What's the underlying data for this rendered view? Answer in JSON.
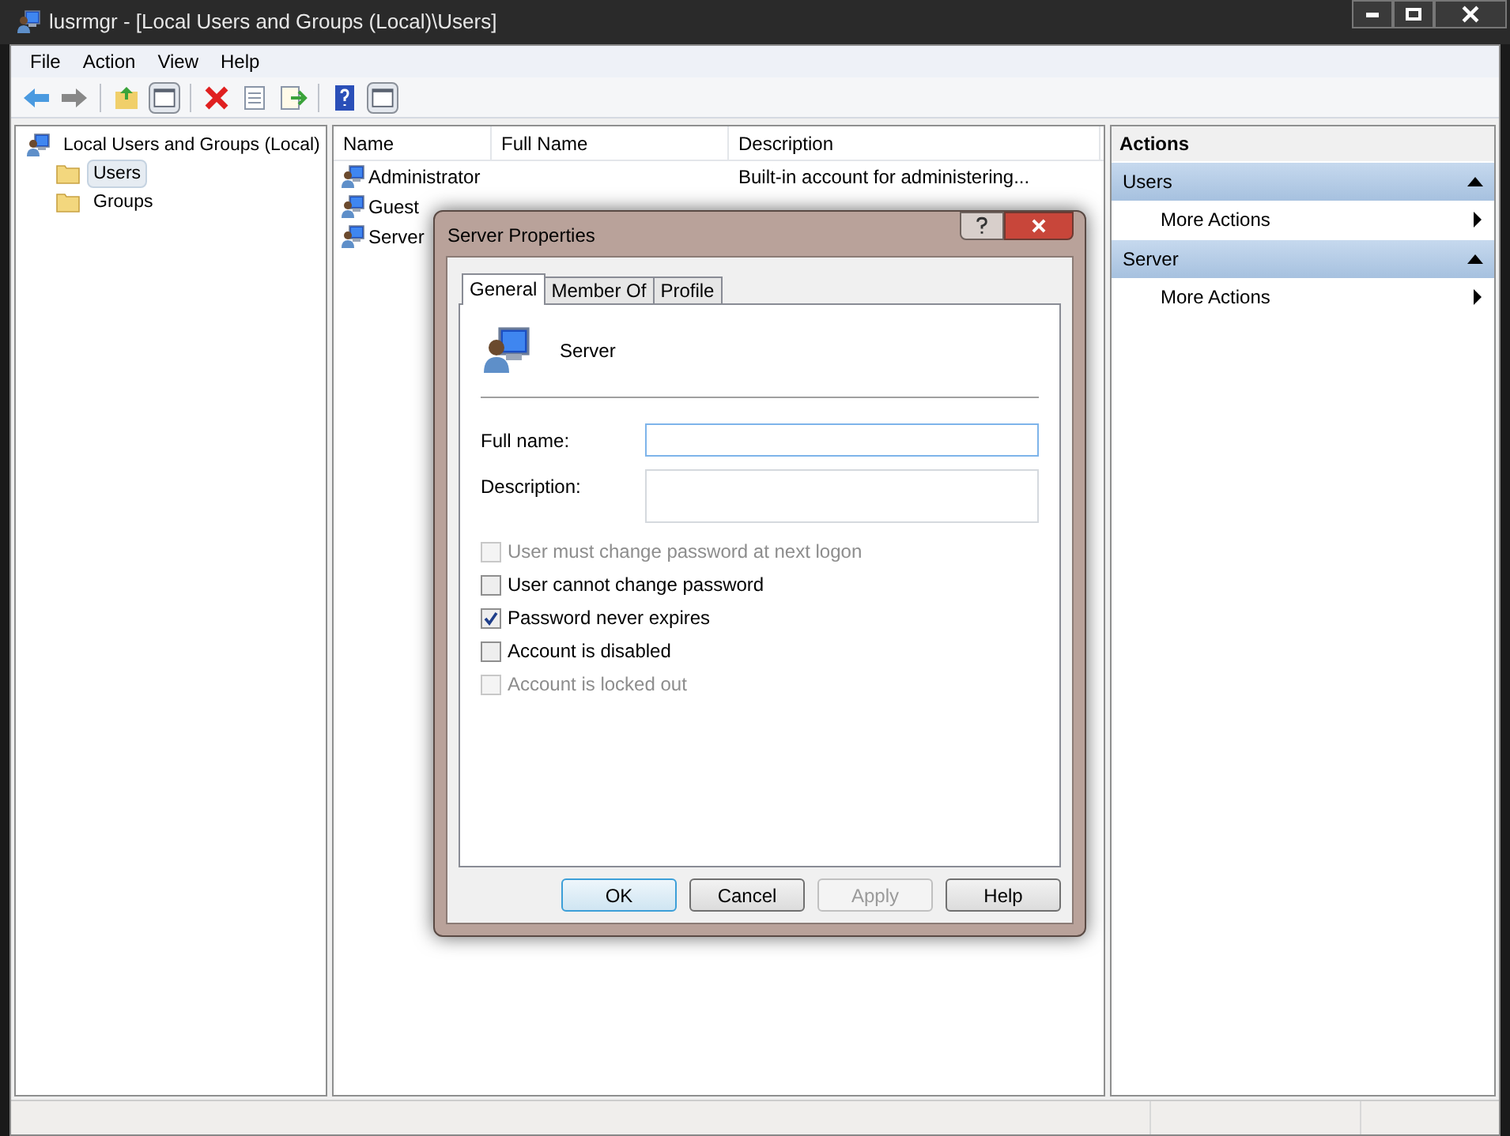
{
  "window": {
    "title": "lusrmgr - [Local Users and Groups (Local)\\Users]"
  },
  "menu": [
    {
      "label": "File"
    },
    {
      "label": "Action"
    },
    {
      "label": "View"
    },
    {
      "label": "Help"
    }
  ],
  "tree": [
    {
      "label": "Local Users and Groups (Local)",
      "kind": "computer",
      "selected": false,
      "children": [
        {
          "label": "Users",
          "kind": "folder",
          "selected": true
        },
        {
          "label": "Groups",
          "kind": "folder",
          "selected": false
        }
      ]
    }
  ],
  "list": {
    "columns": [
      "Name",
      "Full Name",
      "Description"
    ],
    "rows": [
      {
        "name": "Administrator",
        "description": "Built-in account for administering..."
      },
      {
        "name": "Guest"
      },
      {
        "name": "Server"
      }
    ]
  },
  "actions": {
    "title": "Actions",
    "sections": [
      {
        "title": "Users",
        "expanded": true,
        "items": [
          "More Actions"
        ]
      },
      {
        "title": "Server",
        "expanded": true,
        "items": [
          "More Actions"
        ]
      }
    ]
  },
  "dialog": {
    "title": "Server Properties",
    "tabs": [
      {
        "label": "General",
        "selected": true
      },
      {
        "label": "Member Of",
        "selected": false
      },
      {
        "label": "Profile",
        "selected": false
      }
    ],
    "user_name": "Server",
    "fields": [
      {
        "label": "Full name:",
        "kind": "line",
        "focused": true
      },
      {
        "label": "Description:",
        "kind": "box",
        "focused": false
      }
    ],
    "checkboxes": [
      {
        "label": "User must change password at next logon",
        "checked": false,
        "disabled": true
      },
      {
        "label": "User cannot change password",
        "checked": false,
        "disabled": false
      },
      {
        "label": "Password never expires",
        "checked": true,
        "disabled": false
      },
      {
        "label": "Account is disabled",
        "checked": false,
        "disabled": false
      },
      {
        "label": "Account is locked out",
        "checked": false,
        "disabled": true
      }
    ],
    "buttons": [
      {
        "label": "OK",
        "default": true,
        "disabled": false
      },
      {
        "label": "Cancel",
        "default": false,
        "disabled": false
      },
      {
        "label": "Apply",
        "default": false,
        "disabled": true
      },
      {
        "label": "Help",
        "default": false,
        "disabled": false
      }
    ]
  }
}
